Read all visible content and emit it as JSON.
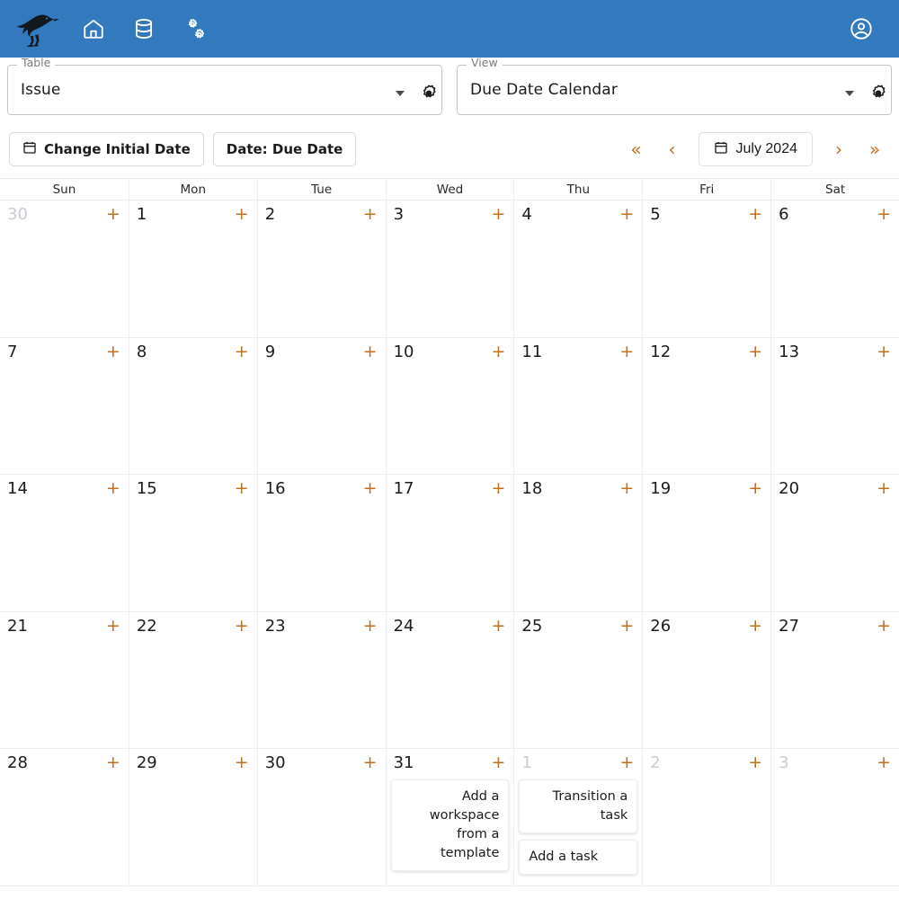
{
  "appbar": {
    "logo_name": "bird-logo",
    "nav": [
      {
        "icon": "home-icon",
        "label": "Home"
      },
      {
        "icon": "database-icon",
        "label": "Database"
      },
      {
        "icon": "gears-icon",
        "label": "Settings"
      }
    ],
    "account_icon": "account-circle-icon",
    "background_color": "#3379bd"
  },
  "selectors": [
    {
      "legend": "Table",
      "value": "Issue",
      "caret_icon": "chevron-down-icon",
      "gear_icon": "gear-icon"
    },
    {
      "legend": "View",
      "value": "Due Date Calendar",
      "caret_icon": "chevron-down-icon",
      "gear_icon": "gear-icon"
    }
  ],
  "toolbar": {
    "change_initial_date_label": "Change Initial Date",
    "change_initial_date_icon": "calendar-icon",
    "date_field_label": "Date: Due Date",
    "nav": {
      "first_label": "«",
      "prev_label": "‹",
      "month_label": "July 2024",
      "month_icon": "calendar-icon",
      "next_label": "›",
      "last_label": "»",
      "accent_color": "#c2701e"
    }
  },
  "calendar": {
    "weekdays": [
      "Sun",
      "Mon",
      "Tue",
      "Wed",
      "Thu",
      "Fri",
      "Sat"
    ],
    "add_label": "+",
    "weeks": [
      [
        {
          "day": "30",
          "muted": true,
          "events": []
        },
        {
          "day": "1",
          "muted": false,
          "events": []
        },
        {
          "day": "2",
          "muted": false,
          "events": []
        },
        {
          "day": "3",
          "muted": false,
          "events": []
        },
        {
          "day": "4",
          "muted": false,
          "events": []
        },
        {
          "day": "5",
          "muted": false,
          "events": []
        },
        {
          "day": "6",
          "muted": false,
          "events": []
        }
      ],
      [
        {
          "day": "7",
          "muted": false,
          "events": []
        },
        {
          "day": "8",
          "muted": false,
          "events": []
        },
        {
          "day": "9",
          "muted": false,
          "events": []
        },
        {
          "day": "10",
          "muted": false,
          "events": []
        },
        {
          "day": "11",
          "muted": false,
          "events": []
        },
        {
          "day": "12",
          "muted": false,
          "events": []
        },
        {
          "day": "13",
          "muted": false,
          "events": []
        }
      ],
      [
        {
          "day": "14",
          "muted": false,
          "events": []
        },
        {
          "day": "15",
          "muted": false,
          "events": []
        },
        {
          "day": "16",
          "muted": false,
          "events": []
        },
        {
          "day": "17",
          "muted": false,
          "events": []
        },
        {
          "day": "18",
          "muted": false,
          "events": []
        },
        {
          "day": "19",
          "muted": false,
          "events": []
        },
        {
          "day": "20",
          "muted": false,
          "events": []
        }
      ],
      [
        {
          "day": "21",
          "muted": false,
          "events": []
        },
        {
          "day": "22",
          "muted": false,
          "events": []
        },
        {
          "day": "23",
          "muted": false,
          "events": []
        },
        {
          "day": "24",
          "muted": false,
          "events": []
        },
        {
          "day": "25",
          "muted": false,
          "events": []
        },
        {
          "day": "26",
          "muted": false,
          "events": []
        },
        {
          "day": "27",
          "muted": false,
          "events": []
        }
      ],
      [
        {
          "day": "28",
          "muted": false,
          "events": []
        },
        {
          "day": "29",
          "muted": false,
          "events": []
        },
        {
          "day": "30",
          "muted": false,
          "events": []
        },
        {
          "day": "31",
          "muted": false,
          "events": [
            {
              "title": "Add a workspace from a template",
              "align": "right"
            }
          ]
        },
        {
          "day": "1",
          "muted": true,
          "events": [
            {
              "title": "Transition a task",
              "align": "right"
            },
            {
              "title": "Add a task",
              "align": "left"
            }
          ]
        },
        {
          "day": "2",
          "muted": true,
          "events": []
        },
        {
          "day": "3",
          "muted": true,
          "events": []
        }
      ]
    ]
  }
}
